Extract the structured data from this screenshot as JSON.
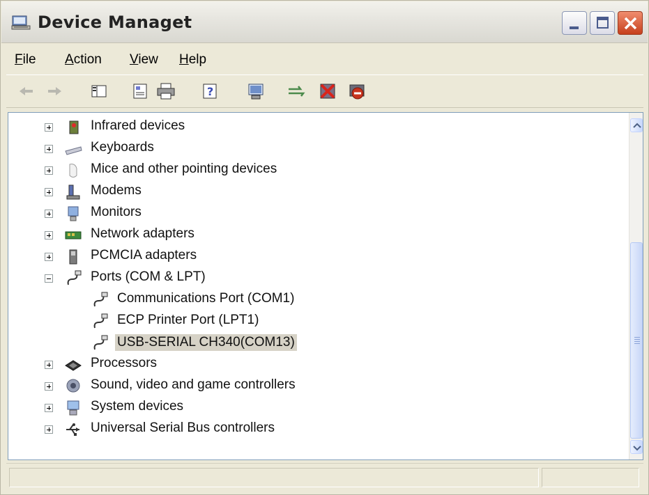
{
  "window": {
    "title": "Device Managet",
    "buttons": {
      "minimize": "minimize",
      "maximize": "maximize",
      "close": "close"
    }
  },
  "menu": {
    "file": {
      "acc": "F",
      "rest": "ile"
    },
    "action": {
      "acc": "A",
      "rest": "ction"
    },
    "view": {
      "acc": "V",
      "rest": "iew"
    },
    "help": {
      "acc": "H",
      "rest": "elp"
    }
  },
  "toolbar": {
    "icons": [
      "back-arrow-icon",
      "forward-arrow-icon",
      "show-hide-tree-icon",
      "properties-icon",
      "print-icon",
      "help-icon",
      "scan-hardware-icon",
      "update-driver-icon",
      "uninstall-icon",
      "disable-icon"
    ]
  },
  "tree": {
    "items": [
      {
        "label": "Infrared devices",
        "icon": "infrared-icon",
        "expander": "plus"
      },
      {
        "label": "Keyboards",
        "icon": "keyboard-icon",
        "expander": "plus"
      },
      {
        "label": "Mice and other pointing devices",
        "icon": "mouse-icon",
        "expander": "plus"
      },
      {
        "label": "Modems",
        "icon": "modem-icon",
        "expander": "plus"
      },
      {
        "label": "Monitors",
        "icon": "monitor-icon",
        "expander": "plus"
      },
      {
        "label": "Network adapters",
        "icon": "network-adapter-icon",
        "expander": "plus"
      },
      {
        "label": "PCMCIA adapters",
        "icon": "pcmcia-icon",
        "expander": "plus"
      },
      {
        "label": "Ports (COM & LPT)",
        "icon": "port-icon",
        "expander": "minus"
      },
      {
        "label": "Communications Port (COM1)",
        "icon": "port-icon",
        "expander": "none"
      },
      {
        "label": "ECP Printer Port (LPT1)",
        "icon": "port-icon",
        "expander": "none"
      },
      {
        "label": "USB-SERIAL CH340(COM13)",
        "icon": "port-icon",
        "expander": "none",
        "selected": true
      },
      {
        "label": "Processors",
        "icon": "processor-icon",
        "expander": "plus"
      },
      {
        "label": "Sound, video and game controllers",
        "icon": "sound-icon",
        "expander": "plus"
      },
      {
        "label": "System devices",
        "icon": "system-devices-icon",
        "expander": "plus"
      },
      {
        "label": "Universal Serial Bus controllers",
        "icon": "usb-icon",
        "expander": "plus"
      }
    ]
  },
  "colors": {
    "chrome": "#ece9d8",
    "selection": "#d6d2c6",
    "close_button": "#c6401d"
  }
}
